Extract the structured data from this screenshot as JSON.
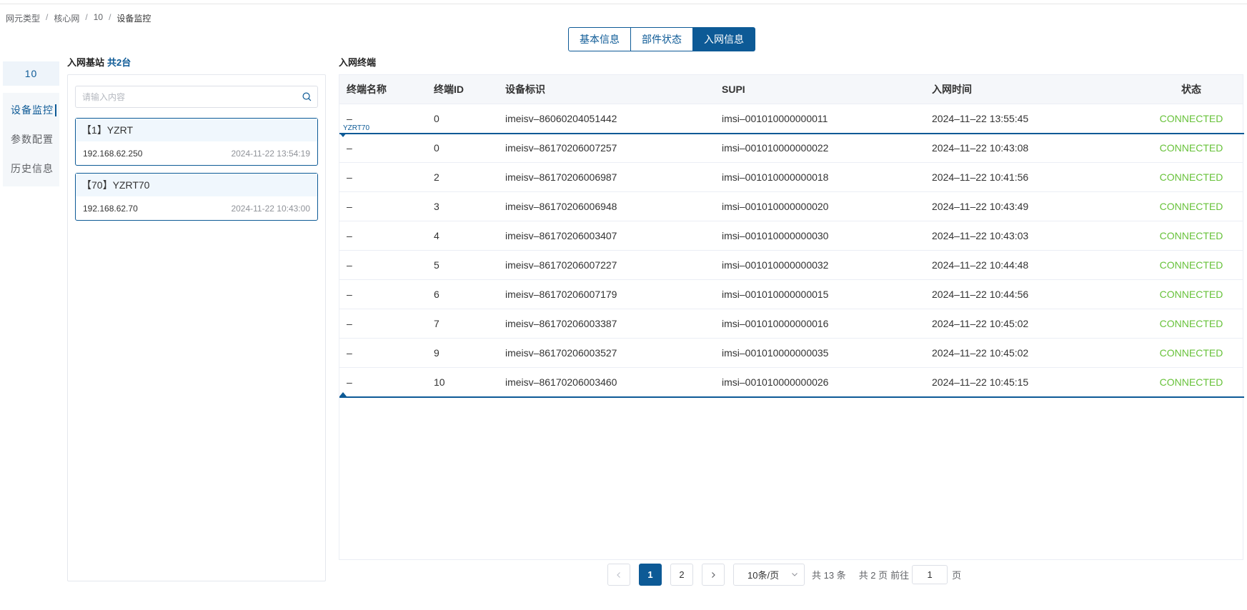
{
  "breadcrumb": [
    "网元类型",
    "核心网",
    "10",
    "设备监控"
  ],
  "tabs": [
    {
      "label": "基本信息",
      "active": false
    },
    {
      "label": "部件状态",
      "active": false
    },
    {
      "label": "入网信息",
      "active": true
    }
  ],
  "sidebar": {
    "node": "10",
    "items": [
      {
        "label": "设备监控",
        "active": true
      },
      {
        "label": "参数配置",
        "active": false
      },
      {
        "label": "历史信息",
        "active": false
      }
    ]
  },
  "stations": {
    "title": "入网基站",
    "count": "共2台",
    "search_placeholder": "请输入内容",
    "items": [
      {
        "name": "【1】YZRT",
        "ip": "192.168.62.250",
        "time": "2024-11-22 13:54:19"
      },
      {
        "name": "【70】YZRT70",
        "ip": "192.168.62.70",
        "time": "2024-11-22 10:43:00"
      }
    ]
  },
  "terminals": {
    "title": "入网终端",
    "group_label": "YZRT70",
    "columns": [
      "终端名称",
      "终端ID",
      "设备标识",
      "SUPI",
      "入网时间",
      "状态"
    ],
    "rows": [
      [
        "–",
        "0",
        "imeisv–86060204051442",
        "imsi–001010000000011",
        "2024–11–22 13:55:45",
        "CONNECTED"
      ],
      [
        "–",
        "0",
        "imeisv–86170206007257",
        "imsi–001010000000022",
        "2024–11–22 10:43:08",
        "CONNECTED"
      ],
      [
        "–",
        "2",
        "imeisv–86170206006987",
        "imsi–001010000000018",
        "2024–11–22 10:41:56",
        "CONNECTED"
      ],
      [
        "–",
        "3",
        "imeisv–86170206006948",
        "imsi–001010000000020",
        "2024–11–22 10:43:49",
        "CONNECTED"
      ],
      [
        "–",
        "4",
        "imeisv–86170206003407",
        "imsi–001010000000030",
        "2024–11–22 10:43:03",
        "CONNECTED"
      ],
      [
        "–",
        "5",
        "imeisv–86170206007227",
        "imsi–001010000000032",
        "2024–11–22 10:44:48",
        "CONNECTED"
      ],
      [
        "–",
        "6",
        "imeisv–86170206007179",
        "imsi–001010000000015",
        "2024–11–22 10:44:56",
        "CONNECTED"
      ],
      [
        "–",
        "7",
        "imeisv–86170206003387",
        "imsi–001010000000016",
        "2024–11–22 10:45:02",
        "CONNECTED"
      ],
      [
        "–",
        "9",
        "imeisv–86170206003527",
        "imsi–001010000000035",
        "2024–11–22 10:45:02",
        "CONNECTED"
      ],
      [
        "–",
        "10",
        "imeisv–86170206003460",
        "imsi–001010000000026",
        "2024–11–22 10:45:15",
        "CONNECTED"
      ]
    ]
  },
  "pagination": {
    "prev_icon": "chevron-left-icon",
    "pages": [
      "1",
      "2"
    ],
    "current": "1",
    "next_icon": "chevron-right-icon",
    "page_size": "10条/页",
    "total": "共 13 条",
    "total_pages": "共 2 页",
    "goto_label": "前往",
    "goto_value": "1",
    "goto_suffix": "页"
  },
  "colors": {
    "accent": "#0d5a96",
    "connected": "#67c23a"
  }
}
